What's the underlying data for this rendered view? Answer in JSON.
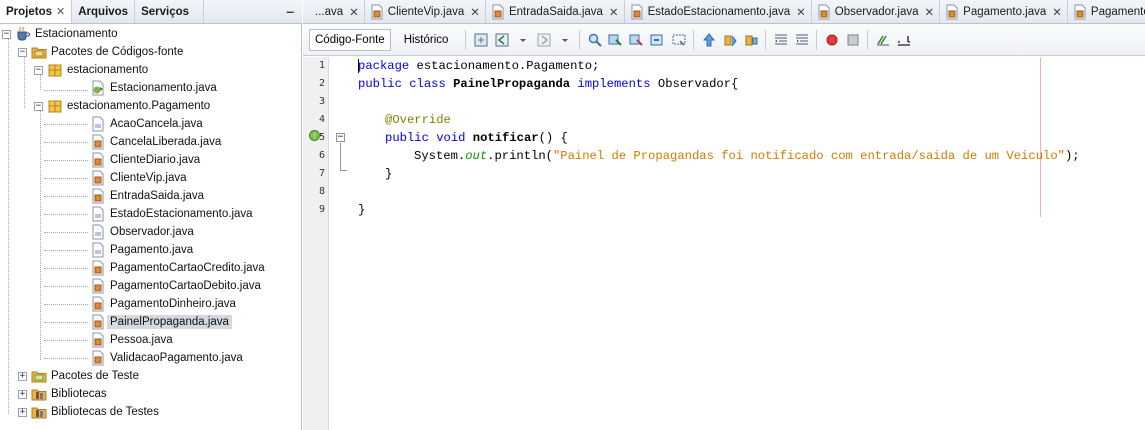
{
  "left_tabs": [
    {
      "label": "Projetos",
      "closable": true
    },
    {
      "label": "Arquivos",
      "closable": false
    },
    {
      "label": "Serviços",
      "closable": false
    }
  ],
  "minimize_label": "–",
  "tree": {
    "root": "Estacionamento",
    "source_packages": "Pacotes de Códigos-fonte",
    "pkg1": "estacionamento",
    "pkg1_files": [
      "Estacionamento.java"
    ],
    "pkg2": "estacionamento.Pagamento",
    "pkg2_files": [
      "AcaoCancela.java",
      "CancelaLiberada.java",
      "ClienteDiario.java",
      "ClienteVip.java",
      "EntradaSaida.java",
      "EstadoEstacionamento.java",
      "Observador.java",
      "Pagamento.java",
      "PagamentoCartaoCredito.java",
      "PagamentoCartaoDebito.java",
      "PagamentoDinheiro.java",
      "PainelPropaganda.java",
      "Pessoa.java",
      "ValidacaoPagamento.java"
    ],
    "selected_file": "PainelPropaganda.java",
    "test_packages": "Pacotes de Teste",
    "libraries": "Bibliotecas",
    "test_libraries": "Bibliotecas de Testes"
  },
  "file_tabs": [
    {
      "label": "...ava",
      "has_icon": false
    },
    {
      "label": "ClienteVip.java",
      "has_icon": true
    },
    {
      "label": "EntradaSaida.java",
      "has_icon": true
    },
    {
      "label": "EstadoEstacionamento.java",
      "has_icon": true
    },
    {
      "label": "Observador.java",
      "has_icon": true
    },
    {
      "label": "Pagamento.java",
      "has_icon": true
    },
    {
      "label": "PagamentoCartaoC",
      "has_icon": true
    }
  ],
  "file_tab_close": "✕",
  "editor_tabs": {
    "source": "Código-Fonte",
    "history": "Histórico"
  },
  "line_numbers": [
    "1",
    "2",
    "3",
    "4",
    "5",
    "6",
    "7",
    "8",
    "9"
  ],
  "code": {
    "l1_kw": "package",
    "l1_rest": " estacionamento.Pagamento;",
    "l2_kw1": "public class",
    "l2_name": " PainelPropaganda ",
    "l2_kw2": "implements",
    "l2_rest": " Observador{",
    "l4": "@Override",
    "l5_kw": "public void",
    "l5_name": " notificar",
    "l5_rest": "() {",
    "l6_pre": "System.",
    "l6_field": "out",
    "l6_mid": ".println(",
    "l6_str": "\"Painel de Propagandas foi notificado com entrada/saida de um Veiculo\"",
    "l6_end": ");",
    "l7": "}",
    "l9": "}"
  },
  "colors": {
    "keyword": "#0000e6",
    "annotation": "#808000",
    "string": "#ce7b00",
    "static_field": "#009900",
    "selection": "#d4d9e0"
  }
}
